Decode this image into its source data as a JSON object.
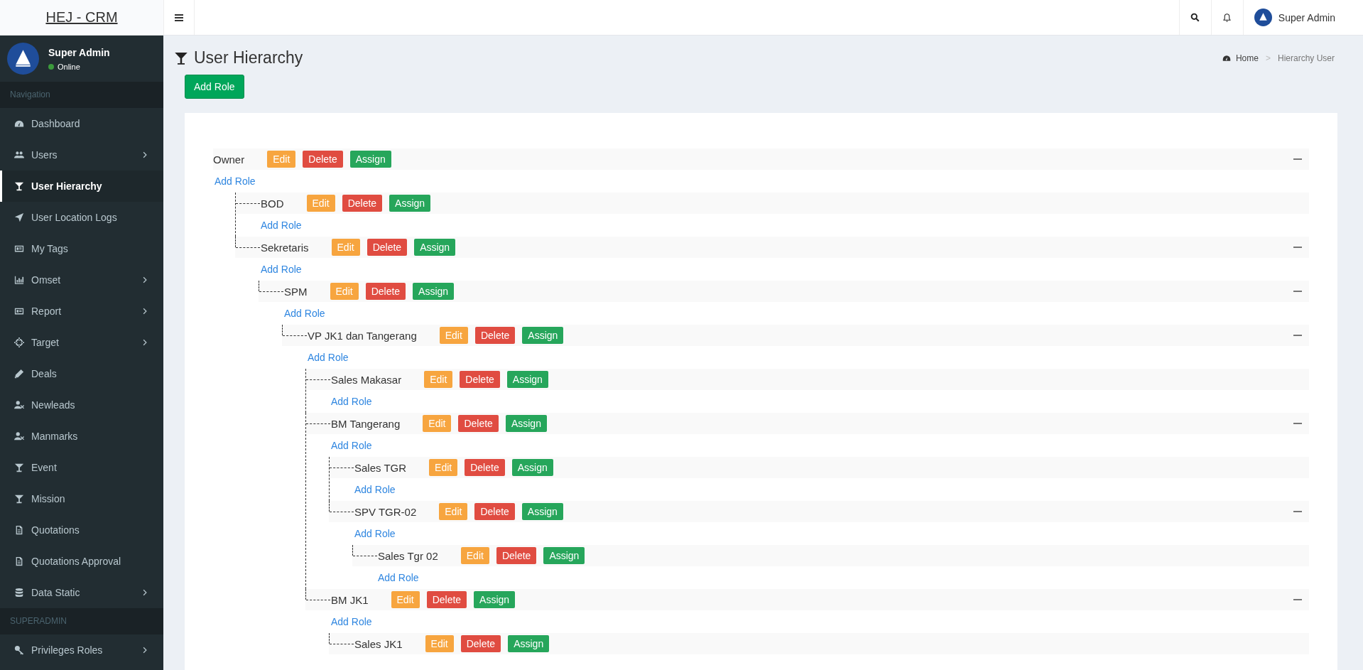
{
  "app": {
    "logo": "HEJ - CRM"
  },
  "topbar": {
    "user_name": "Super Admin"
  },
  "sidebar": {
    "user": {
      "name": "Super Admin",
      "status": "Online"
    },
    "sections": [
      {
        "header": "Navigation",
        "items": [
          {
            "label": "Dashboard",
            "selected": false,
            "has_submenu": false
          },
          {
            "label": "Users",
            "selected": false,
            "has_submenu": true
          },
          {
            "label": "User Hierarchy",
            "selected": true,
            "has_submenu": false
          },
          {
            "label": "User Location Logs",
            "selected": false,
            "has_submenu": false
          },
          {
            "label": "My Tags",
            "selected": false,
            "has_submenu": false
          },
          {
            "label": "Omset",
            "selected": false,
            "has_submenu": true
          },
          {
            "label": "Report",
            "selected": false,
            "has_submenu": true
          },
          {
            "label": "Target",
            "selected": false,
            "has_submenu": true
          },
          {
            "label": "Deals",
            "selected": false,
            "has_submenu": false
          },
          {
            "label": "Newleads",
            "selected": false,
            "has_submenu": false
          },
          {
            "label": "Manmarks",
            "selected": false,
            "has_submenu": false
          },
          {
            "label": "Event",
            "selected": false,
            "has_submenu": false
          },
          {
            "label": "Mission",
            "selected": false,
            "has_submenu": false
          },
          {
            "label": "Quotations",
            "selected": false,
            "has_submenu": false
          },
          {
            "label": "Quotations Approval",
            "selected": false,
            "has_submenu": false
          },
          {
            "label": "Data Static",
            "selected": false,
            "has_submenu": true
          }
        ]
      },
      {
        "header": "SUPERADMIN",
        "items": [
          {
            "label": "Privileges Roles",
            "selected": false,
            "has_submenu": true
          }
        ]
      }
    ]
  },
  "page": {
    "title": "User Hierarchy",
    "breadcrumb": {
      "home": "Home",
      "separator": ">",
      "current": "Hierarchy User"
    },
    "add_button": "Add Role"
  },
  "tree": [
    {
      "name": "Owner",
      "expanded": true,
      "actions": [
        {
          "kind": "edit",
          "label": "Edit"
        },
        {
          "kind": "delete",
          "label": "Delete"
        },
        {
          "kind": "assign",
          "label": "Assign"
        }
      ],
      "add_link": "Add Role",
      "children": [
        {
          "name": "BOD",
          "expanded": false,
          "actions": [
            {
              "kind": "edit",
              "label": "Edit"
            },
            {
              "kind": "delete",
              "label": "Delete"
            },
            {
              "kind": "assign",
              "label": "Assign"
            }
          ],
          "add_link": "Add Role"
        },
        {
          "name": "Sekretaris",
          "expanded": true,
          "actions": [
            {
              "kind": "edit",
              "label": "Edit"
            },
            {
              "kind": "delete",
              "label": "Delete"
            },
            {
              "kind": "assign",
              "label": "Assign"
            }
          ],
          "add_link": "Add Role",
          "children": [
            {
              "name": "SPM",
              "expanded": true,
              "actions": [
                {
                  "kind": "edit",
                  "label": "Edit"
                },
                {
                  "kind": "delete",
                  "label": "Delete"
                },
                {
                  "kind": "assign",
                  "label": "Assign"
                }
              ],
              "add_link": "Add Role",
              "children": [
                {
                  "name": "VP JK1 dan Tangerang",
                  "expanded": true,
                  "actions": [
                    {
                      "kind": "edit",
                      "label": "Edit"
                    },
                    {
                      "kind": "delete",
                      "label": "Delete"
                    },
                    {
                      "kind": "assign",
                      "label": "Assign"
                    }
                  ],
                  "add_link": "Add Role",
                  "children": [
                    {
                      "name": "Sales Makasar",
                      "expanded": false,
                      "actions": [
                        {
                          "kind": "edit",
                          "label": "Edit"
                        },
                        {
                          "kind": "delete",
                          "label": "Delete"
                        },
                        {
                          "kind": "assign",
                          "label": "Assign"
                        }
                      ],
                      "add_link": "Add Role"
                    },
                    {
                      "name": "BM Tangerang",
                      "expanded": true,
                      "actions": [
                        {
                          "kind": "edit",
                          "label": "Edit"
                        },
                        {
                          "kind": "delete",
                          "label": "Delete"
                        },
                        {
                          "kind": "assign",
                          "label": "Assign"
                        }
                      ],
                      "add_link": "Add Role",
                      "children": [
                        {
                          "name": "Sales TGR",
                          "expanded": false,
                          "actions": [
                            {
                              "kind": "edit",
                              "label": "Edit"
                            },
                            {
                              "kind": "delete",
                              "label": "Delete"
                            },
                            {
                              "kind": "assign",
                              "label": "Assign"
                            }
                          ],
                          "add_link": "Add Role"
                        },
                        {
                          "name": "SPV TGR-02",
                          "expanded": true,
                          "actions": [
                            {
                              "kind": "edit",
                              "label": "Edit"
                            },
                            {
                              "kind": "delete",
                              "label": "Delete"
                            },
                            {
                              "kind": "assign",
                              "label": "Assign"
                            }
                          ],
                          "add_link": "Add Role",
                          "children": [
                            {
                              "name": "Sales Tgr 02",
                              "expanded": false,
                              "actions": [
                                {
                                  "kind": "edit",
                                  "label": "Edit"
                                },
                                {
                                  "kind": "delete",
                                  "label": "Delete"
                                },
                                {
                                  "kind": "assign",
                                  "label": "Assign"
                                }
                              ],
                              "add_link": "Add Role"
                            }
                          ]
                        }
                      ]
                    },
                    {
                      "name": "BM JK1",
                      "expanded": true,
                      "actions": [
                        {
                          "kind": "edit",
                          "label": "Edit"
                        },
                        {
                          "kind": "delete",
                          "label": "Delete"
                        },
                        {
                          "kind": "assign",
                          "label": "Assign"
                        }
                      ],
                      "add_link": "Add Role",
                      "children": [
                        {
                          "name": "Sales JK1",
                          "expanded": false,
                          "actions": [
                            {
                              "kind": "edit",
                              "label": "Edit"
                            },
                            {
                              "kind": "delete",
                              "label": "Delete"
                            },
                            {
                              "kind": "assign",
                              "label": "Assign"
                            }
                          ]
                        }
                      ]
                    }
                  ]
                }
              ]
            }
          ]
        }
      ]
    }
  ]
}
